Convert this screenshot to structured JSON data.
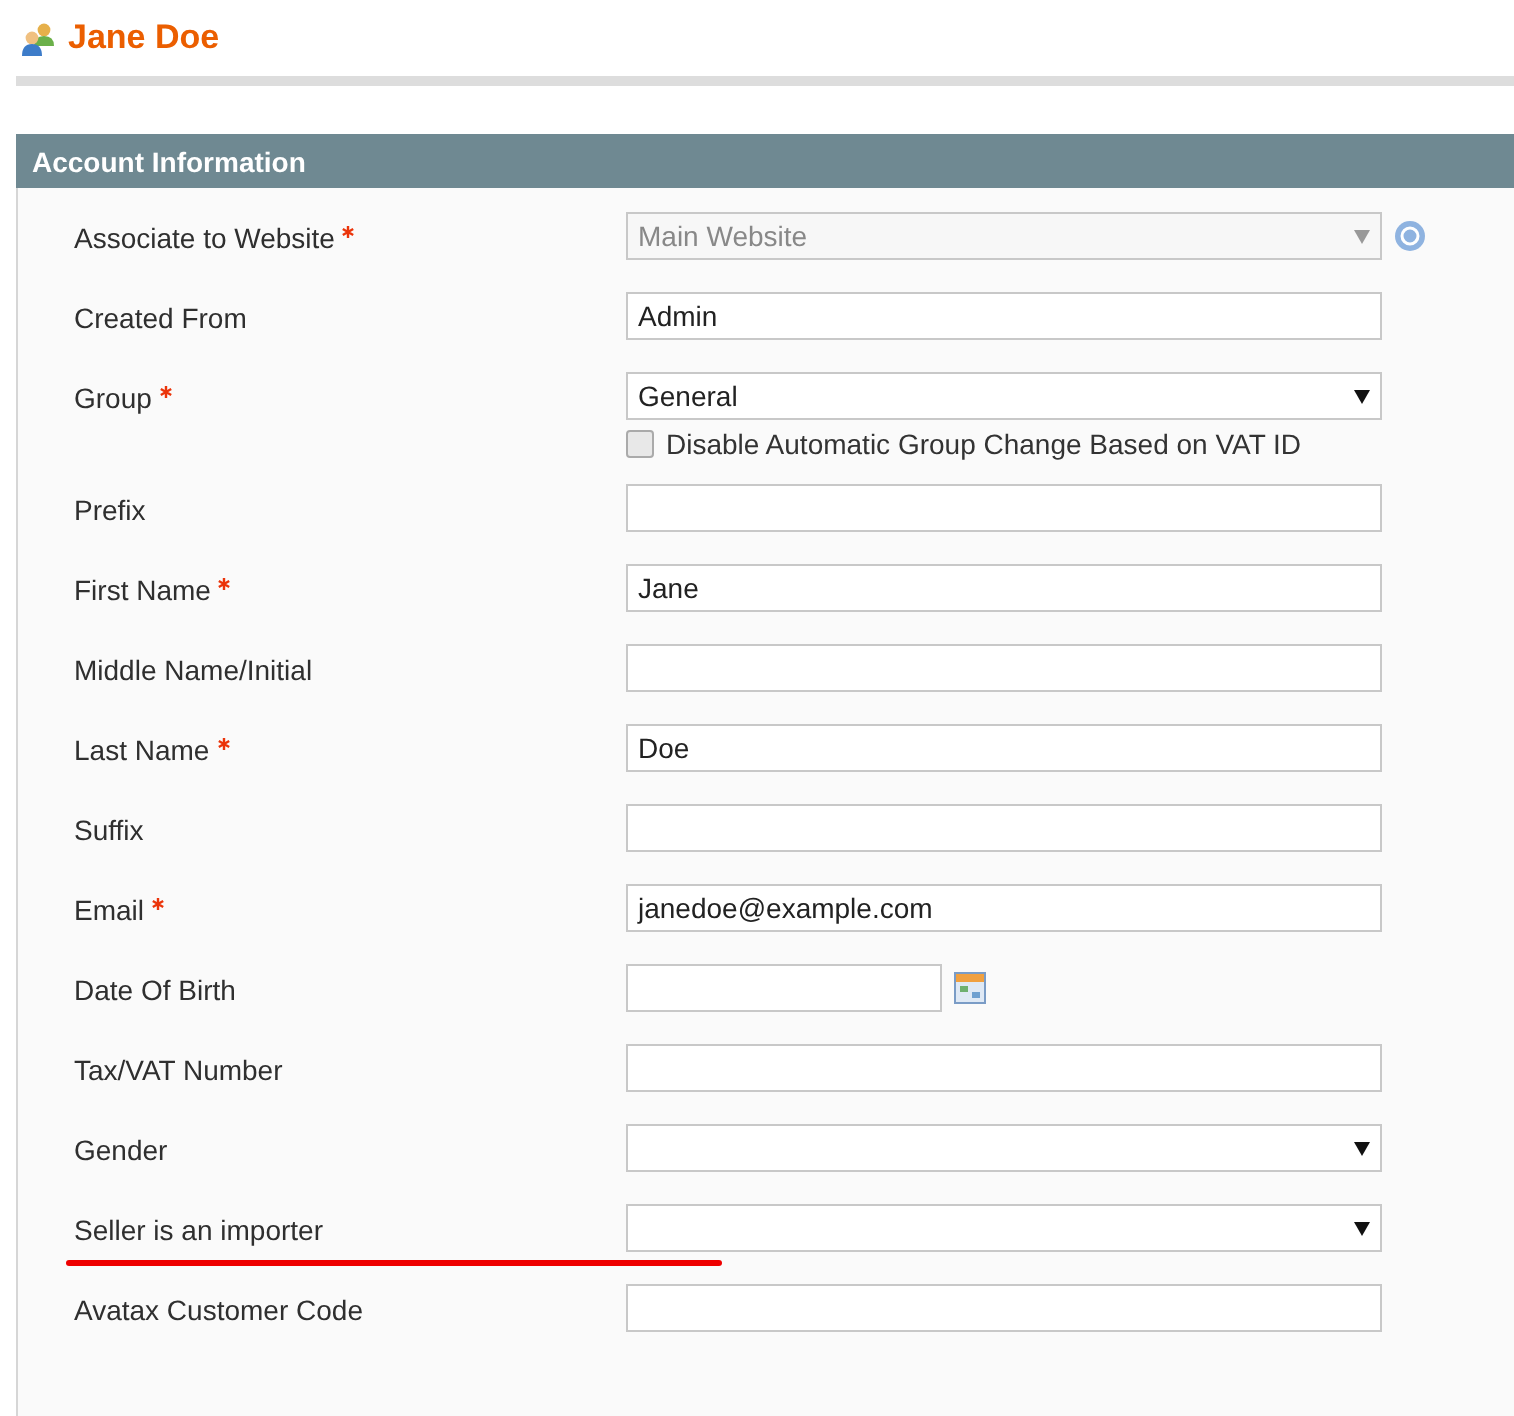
{
  "page_title": "Jane Doe",
  "section": {
    "title": "Account Information"
  },
  "fields": [
    {
      "label": "Associate to Website",
      "required": true,
      "kind": "select",
      "value": "Main Website",
      "disabled": true,
      "help": true
    },
    {
      "label": "Created From",
      "required": false,
      "kind": "text",
      "value": "Admin"
    },
    {
      "label": "Group",
      "required": true,
      "kind": "select",
      "value": "General",
      "checkbox": {
        "label": "Disable Automatic Group Change Based on VAT ID",
        "checked": false
      }
    },
    {
      "label": "Prefix",
      "required": false,
      "kind": "text"
    },
    {
      "label": "First Name",
      "required": true,
      "kind": "text",
      "value": "Jane"
    },
    {
      "label": "Middle Name/Initial",
      "required": false,
      "kind": "text"
    },
    {
      "label": "Last Name",
      "required": true,
      "kind": "text",
      "value": "Doe"
    },
    {
      "label": "Suffix",
      "required": false,
      "kind": "text"
    },
    {
      "label": "Email",
      "required": true,
      "kind": "text",
      "value": "janedoe@example.com"
    },
    {
      "label": "Date Of Birth",
      "required": false,
      "kind": "date"
    },
    {
      "label": "Tax/VAT Number",
      "required": false,
      "kind": "text"
    },
    {
      "label": "Gender",
      "required": false,
      "kind": "select"
    },
    {
      "label": "Seller is an importer",
      "required": false,
      "kind": "select",
      "underlined": true
    },
    {
      "label": "Avatax Customer Code",
      "required": false,
      "kind": "text"
    }
  ]
}
